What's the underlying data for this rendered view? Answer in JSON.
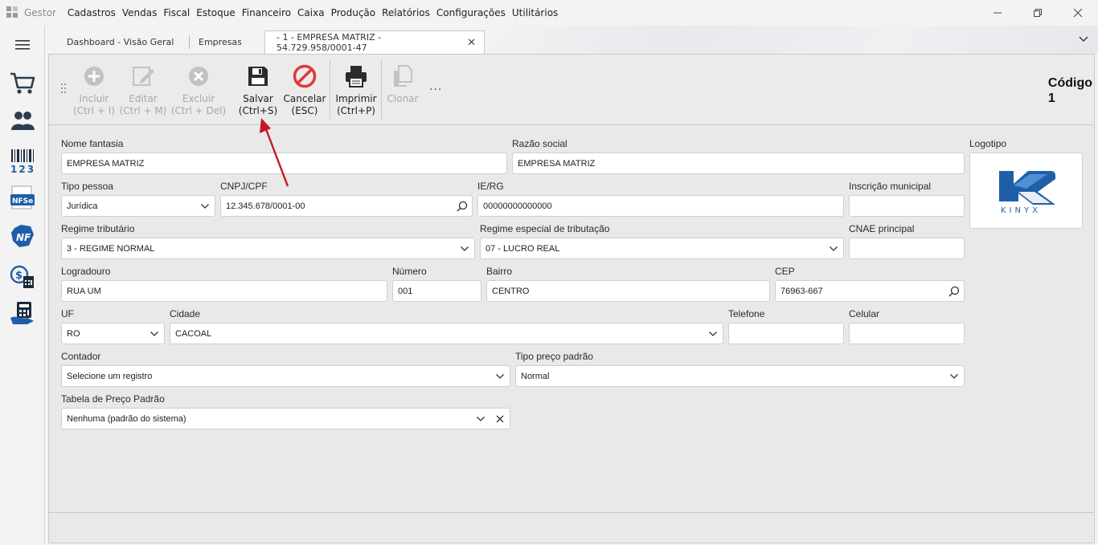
{
  "app": {
    "name": "Gestor"
  },
  "menu": [
    "Cadastros",
    "Vendas",
    "Fiscal",
    "Estoque",
    "Financeiro",
    "Caixa",
    "Produção",
    "Relatórios",
    "Configurações",
    "Utilitários"
  ],
  "window_controls": {
    "minimize": "—",
    "restore": "❐",
    "close": "✕"
  },
  "rail": [
    "cart-icon",
    "people-icon",
    "barcode-icon",
    "nfse-icon",
    "nfe-icon",
    "cash-register-icon",
    "calculator-icon"
  ],
  "rail_text": {
    "barcode": "123",
    "nfse": "NFSe",
    "nfe": "NF e"
  },
  "tabs": [
    {
      "label": "Dashboard - Visão Geral"
    },
    {
      "label": "Empresas"
    },
    {
      "label": "- 1 - EMPRESA MATRIZ - 54.729.958/0001-47",
      "close": "✕"
    }
  ],
  "toolbar": {
    "incluir": {
      "label": "Incluir",
      "shortcut": "(Ctrl + I)"
    },
    "editar": {
      "label": "Editar",
      "shortcut": "(Ctrl + M)"
    },
    "excluir": {
      "label": "Excluir",
      "shortcut": "(Ctrl + Del)"
    },
    "salvar": {
      "label": "Salvar",
      "shortcut": "(Ctrl+S)"
    },
    "cancelar": {
      "label": "Cancelar",
      "shortcut": "(ESC)"
    },
    "imprimir": {
      "label": "Imprimir",
      "shortcut": "(Ctrl+P)"
    },
    "clonar": {
      "label": "Clonar"
    },
    "more": "..."
  },
  "codigo": {
    "label": "Código",
    "value": "1"
  },
  "form": {
    "nome_fantasia": {
      "label": "Nome fantasia",
      "value": "EMPRESA MATRIZ"
    },
    "razao_social": {
      "label": "Razão social",
      "value": "EMPRESA MATRIZ"
    },
    "logotipo": {
      "label": "Logotipo",
      "brand": "KINYX"
    },
    "tipo_pessoa": {
      "label": "Tipo pessoa",
      "value": "Jurídica"
    },
    "cnpj_cpf": {
      "label": "CNPJ/CPF",
      "value": "12.345.678/0001-00"
    },
    "ie_rg": {
      "label": "IE/RG",
      "value": "00000000000000"
    },
    "inscricao_municipal": {
      "label": "Inscrição municipal",
      "value": ""
    },
    "regime_tributario": {
      "label": "Regime tributário",
      "value": "3 - REGIME NORMAL"
    },
    "regime_especial": {
      "label": "Regime especial de tributação",
      "value": "07 - LUCRO REAL"
    },
    "cnae_principal": {
      "label": "CNAE principal",
      "value": ""
    },
    "logradouro": {
      "label": "Logradouro",
      "value": "RUA UM"
    },
    "numero": {
      "label": "Número",
      "value": "001"
    },
    "bairro": {
      "label": "Bairro",
      "value": "CENTRO"
    },
    "cep": {
      "label": "CEP",
      "value": "76963-667"
    },
    "uf": {
      "label": "UF",
      "value": "RO"
    },
    "cidade": {
      "label": "Cidade",
      "value": "CACOAL"
    },
    "telefone": {
      "label": "Telefone",
      "value": ""
    },
    "celular": {
      "label": "Celular",
      "value": ""
    },
    "contador": {
      "label": "Contador",
      "value": "Selecione um registro"
    },
    "tipo_preco_padrao": {
      "label": "Tipo preço padrão",
      "value": "Normal"
    },
    "tabela_preco_padrao": {
      "label": "Tabela de Preço Padrão",
      "value": "Nenhuma (padrão do sistema)"
    }
  },
  "colors": {
    "save_icon": "#2b2b2b",
    "cancel_icon": "#e0383e",
    "annotation_arrow": "#c8171e",
    "brand_blue": "#1f5fa8"
  }
}
